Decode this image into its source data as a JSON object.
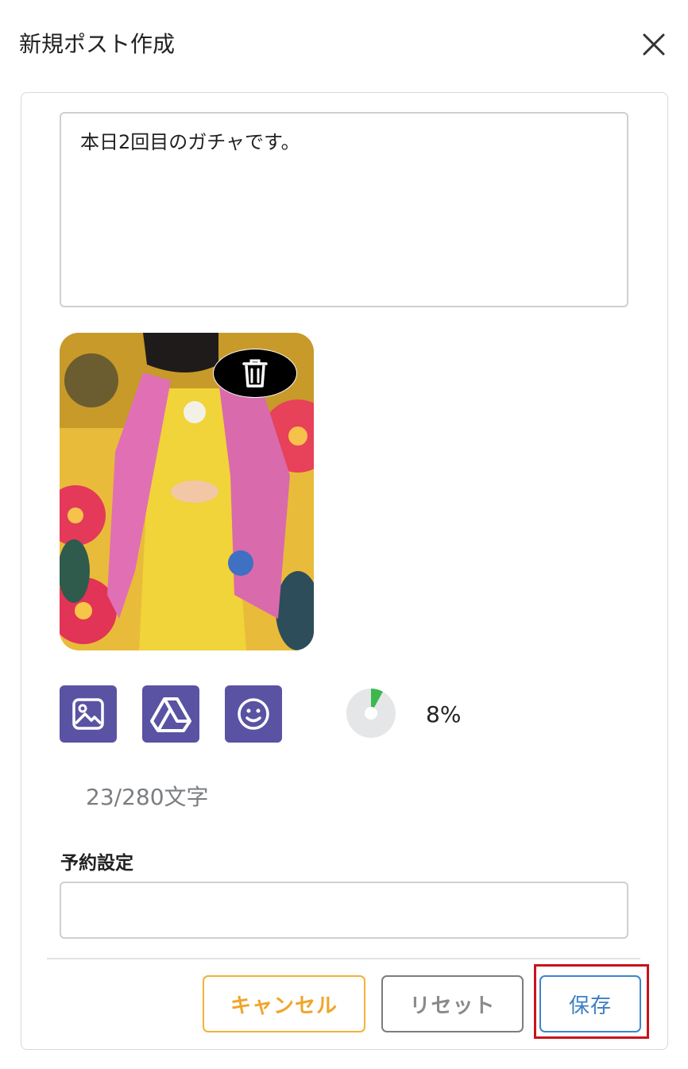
{
  "header": {
    "title": "新規ポスト作成"
  },
  "post": {
    "text": "本日2回目のガチャです。"
  },
  "stats": {
    "percent_label": "8%",
    "progress_value": 0.08,
    "char_count": "23/280文字"
  },
  "schedule": {
    "label": "予約設定",
    "value": ""
  },
  "buttons": {
    "cancel": "キャンセル",
    "reset": "リセット",
    "save": "保存"
  },
  "icons": {
    "close": "close-icon",
    "trash": "trash-icon",
    "image": "image-icon",
    "drive": "google-drive-icon",
    "emoji": "smiley-icon"
  },
  "colors": {
    "tool_button": "#5a52a3",
    "progress": "#3db84d",
    "cancel": "#f0a52a",
    "save": "#3c7fc4",
    "highlight": "#c8141c"
  }
}
